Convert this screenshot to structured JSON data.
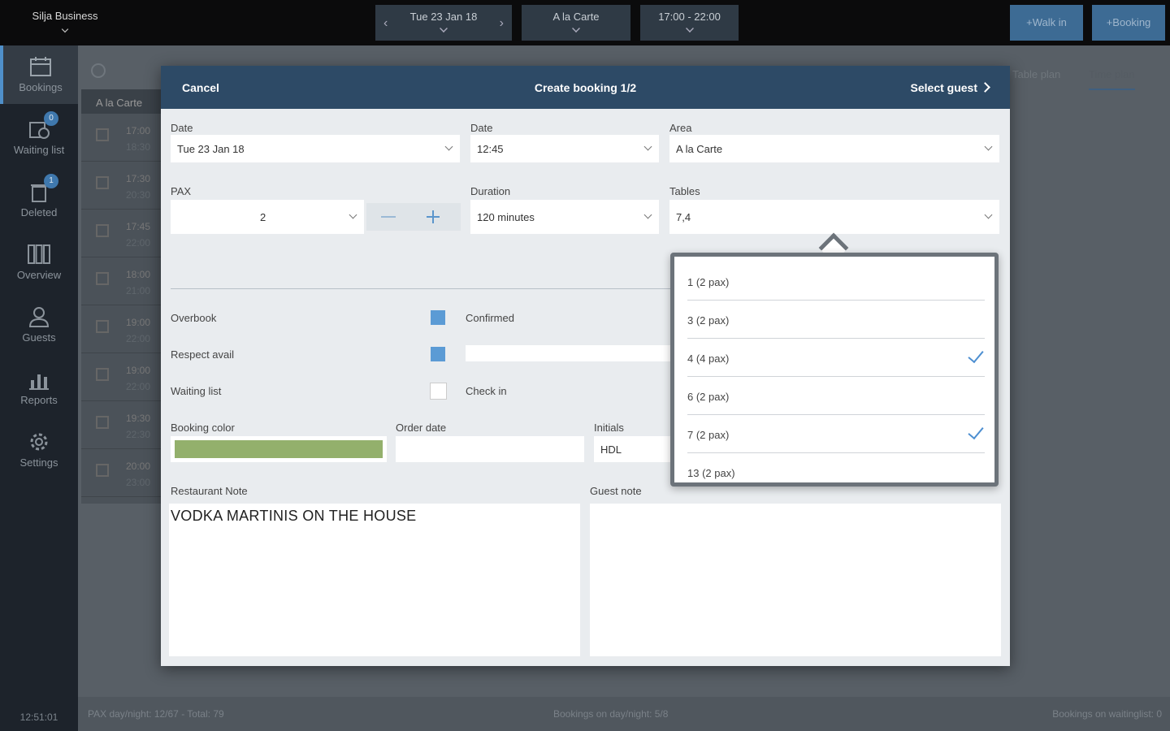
{
  "topbar": {
    "venue": "Silja Business",
    "date": "Tue 23 Jan 18",
    "area": "A la Carte",
    "time_range": "17:00 - 22:00",
    "walkin_label": "+Walk in",
    "booking_label": "+Booking"
  },
  "sidebar": {
    "items": [
      {
        "label": "Bookings",
        "icon": "calendar-icon"
      },
      {
        "label": "Waiting list",
        "icon": "clock-icon",
        "badge": "0"
      },
      {
        "label": "Deleted",
        "icon": "trash-icon",
        "badge": "1"
      },
      {
        "label": "Overview",
        "icon": "columns-icon"
      },
      {
        "label": "Guests",
        "icon": "user-icon"
      },
      {
        "label": "Reports",
        "icon": "bar-chart-icon"
      },
      {
        "label": "Settings",
        "icon": "gear-icon"
      }
    ],
    "clock": "12:51:01"
  },
  "background": {
    "area_header": "A la Carte",
    "tabs": [
      "Table plan",
      "Time plan"
    ],
    "rows": [
      {
        "start": "17:00",
        "end": "18:30"
      },
      {
        "start": "17:30",
        "end": "20:30"
      },
      {
        "start": "17:45",
        "end": "22:00"
      },
      {
        "start": "18:00",
        "end": "21:00"
      },
      {
        "start": "19:00",
        "end": "22:00"
      },
      {
        "start": "19:00",
        "end": "22:00"
      },
      {
        "start": "19:30",
        "end": "22:30"
      },
      {
        "start": "20:00",
        "end": "23:00"
      }
    ],
    "status": {
      "pax": "PAX day/night: 12/67 - Total: 79",
      "bookings": "Bookings on day/night: 5/8",
      "waiting": "Bookings on waitinglist: 0"
    }
  },
  "dialog": {
    "cancel_label": "Cancel",
    "title": "Create booking 1/2",
    "next_label": "Select guest",
    "date_label": "Date",
    "date_value": "Tue 23 Jan 18",
    "time_label": "Date",
    "time_value": "12:45",
    "area_label": "Area",
    "area_value": "A la Carte",
    "pax_label": "PAX",
    "pax_value": "2",
    "duration_label": "Duration",
    "duration_value": "120 minutes",
    "tables_label": "Tables",
    "tables_value": "7,4",
    "overbook_label": "Overbook",
    "overbook_checked": true,
    "respect_label": "Respect avail",
    "respect_checked": true,
    "waiting_label": "Waiting list",
    "waiting_checked": false,
    "confirmed_label": "Confirmed",
    "checkin_label": "Check in",
    "booking_color_label": "Booking color",
    "booking_color": "#93b06c",
    "order_date_label": "Order date",
    "order_date_value": "",
    "initials_label": "Initials",
    "initials_value": "HDL",
    "restaurant_note_label": "Restaurant Note",
    "restaurant_note": "VODKA MARTINIS ON THE HOUSE",
    "guest_note_label": "Guest note",
    "guest_note": ""
  },
  "tables_dropdown": [
    {
      "label": "1 (2 pax)",
      "selected": false
    },
    {
      "label": "3 (2 pax)",
      "selected": false
    },
    {
      "label": "4 (4 pax)",
      "selected": true
    },
    {
      "label": "6 (2 pax)",
      "selected": false
    },
    {
      "label": "7 (2 pax)",
      "selected": true
    },
    {
      "label": "13 (2 pax)",
      "selected": false
    }
  ],
  "colors": {
    "header": "#2d4a66",
    "accent": "#5b9bd5",
    "sidebar": "#1d232b"
  }
}
